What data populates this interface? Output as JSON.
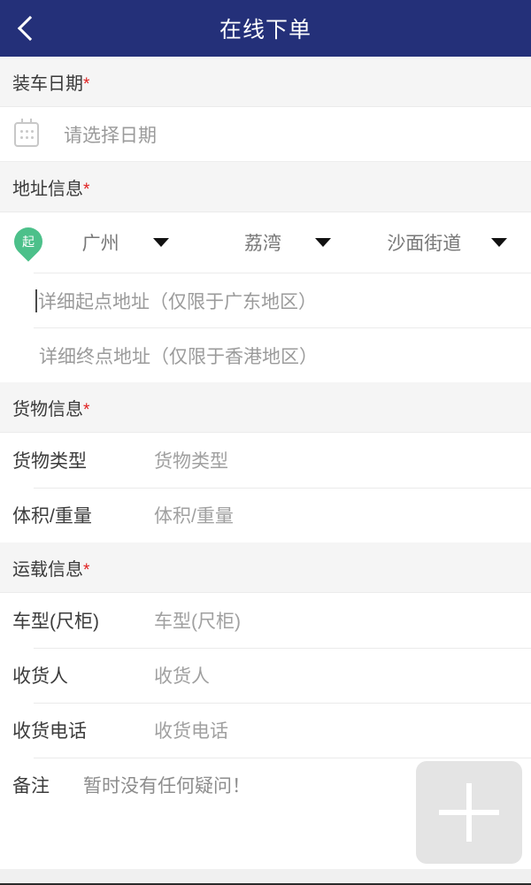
{
  "header": {
    "title": "在线下单",
    "back_icon": "chevron-left-icon",
    "background": "#243079"
  },
  "sections": {
    "load_date": {
      "title": "装车日期",
      "required_mark": "*",
      "date_field": {
        "icon": "calendar-icon",
        "placeholder": "请选择日期",
        "value": ""
      }
    },
    "address": {
      "title": "地址信息",
      "required_mark": "*",
      "origin_pin": {
        "icon": "map-pin-icon",
        "label": "起",
        "color": "#4cc08a"
      },
      "region_selects": [
        {
          "name": "city",
          "value": "广州",
          "caret": "caret-down-icon"
        },
        {
          "name": "district",
          "value": "荔湾",
          "caret": "caret-down-icon"
        },
        {
          "name": "street",
          "value": "沙面街道",
          "caret": "caret-down-icon"
        }
      ],
      "origin_detail": {
        "placeholder": "详细起点地址（仅限于广东地区）",
        "value": "",
        "focused": true
      },
      "destination_detail": {
        "placeholder": "详细终点地址（仅限于香港地区）",
        "value": ""
      }
    },
    "cargo": {
      "title": "货物信息",
      "required_mark": "*",
      "rows": [
        {
          "label": "货物类型",
          "value": "货物类型"
        },
        {
          "label": "体积/重量",
          "value": "体积/重量"
        }
      ]
    },
    "transport": {
      "title": "运载信息",
      "required_mark": "*",
      "rows": [
        {
          "label": "车型(尺柜)",
          "value": "车型(尺柜)"
        },
        {
          "label": "收货人",
          "value": "收货人"
        },
        {
          "label": "收货电话",
          "value": "收货电话"
        }
      ],
      "remark": {
        "label": "备注",
        "value": "暂时没有任何疑问！"
      }
    }
  },
  "add_button": {
    "icon": "plus-icon",
    "color": "#e4e4e4"
  }
}
